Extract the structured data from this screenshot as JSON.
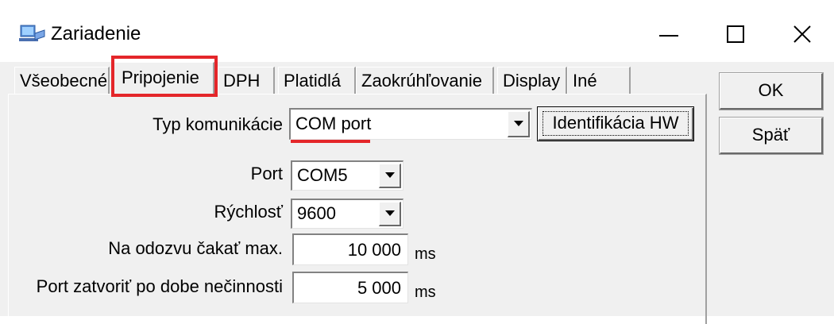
{
  "window": {
    "title": "Zariadenie",
    "icon": "computer-icon",
    "minimize_icon": "minimize-icon",
    "maximize_icon": "maximize-icon",
    "close_icon": "close-icon"
  },
  "tabs": [
    {
      "label": "Všeobecné"
    },
    {
      "label": "Pripojenie",
      "active": true
    },
    {
      "label": "DPH"
    },
    {
      "label": "Platidlá"
    },
    {
      "label": "Zaokrúhľovanie"
    },
    {
      "label": "Display"
    },
    {
      "label": "Iné"
    }
  ],
  "form": {
    "comm_type_label": "Typ komunikácie",
    "comm_type_value": "COM port",
    "hw_button_label": "Identifikácia HW",
    "port_label": "Port",
    "port_value": "COM5",
    "speed_label": "Rýchlosť",
    "speed_value": "9600",
    "timeout_label": "Na odozvu čakať max.",
    "timeout_value": "10 000",
    "timeout_unit": "ms",
    "idle_label": "Port zatvoriť po dobe nečinnosti",
    "idle_value": "5 000",
    "idle_unit": "ms"
  },
  "buttons": {
    "ok": "OK",
    "back": "Späť"
  },
  "colors": {
    "highlight": "#e4262a",
    "window_bg": "#f0f0f0"
  }
}
